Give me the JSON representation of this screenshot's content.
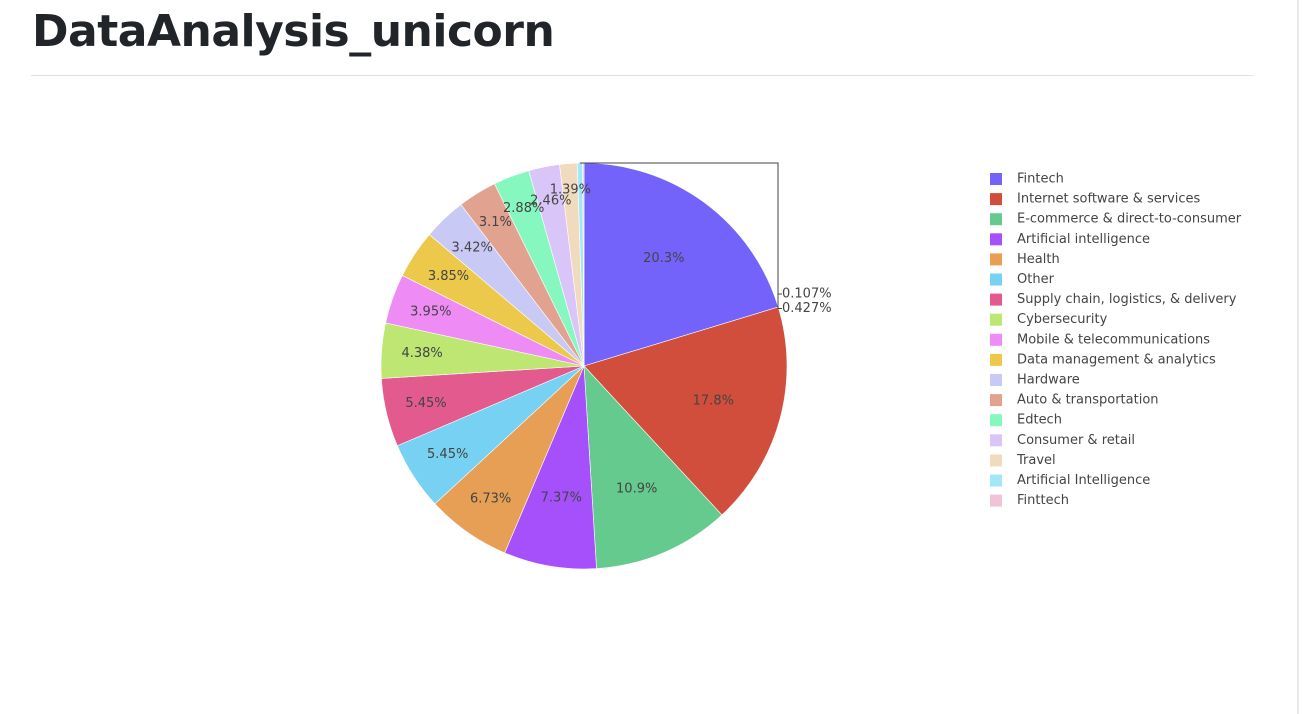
{
  "page": {
    "title": "DataAnalysis_unicorn"
  },
  "chart_data": {
    "type": "pie",
    "direction": "clockwise",
    "start": "12 o'clock",
    "legend_placement": "right",
    "slices": [
      {
        "name": "Fintech",
        "percent": 20.3,
        "label": "20.3%",
        "color": "#7463fb",
        "label_color": "#ffffff"
      },
      {
        "name": "Internet software & services",
        "percent": 17.8,
        "label": "17.8%",
        "color": "#d14e3c",
        "label_color": "#444444"
      },
      {
        "name": "E-commerce & direct-to-consumer",
        "percent": 10.9,
        "label": "10.9%",
        "color": "#64ca8e",
        "label_color": "#444444"
      },
      {
        "name": "Artificial intelligence",
        "percent": 7.37,
        "label": "7.37%",
        "color": "#a650fb",
        "label_color": "#444444"
      },
      {
        "name": "Health",
        "percent": 6.73,
        "label": "6.73%",
        "color": "#e69f55",
        "label_color": "#444444"
      },
      {
        "name": "Other",
        "percent": 5.45,
        "label": "5.45%",
        "color": "#76d1f3",
        "label_color": "#444444"
      },
      {
        "name": "Supply chain, logistics, & delivery",
        "percent": 5.45,
        "label": "5.45%",
        "color": "#e35a8f",
        "label_color": "#444444"
      },
      {
        "name": "Cybersecurity",
        "percent": 4.38,
        "label": "4.38%",
        "color": "#bde672",
        "label_color": "#444444"
      },
      {
        "name": "Mobile & telecommunications",
        "percent": 3.95,
        "label": "3.95%",
        "color": "#ee8bf4",
        "label_color": "#444444"
      },
      {
        "name": "Data management & analytics",
        "percent": 3.85,
        "label": "3.85%",
        "color": "#ecc94a",
        "label_color": "#444444"
      },
      {
        "name": "Hardware",
        "percent": 3.42,
        "label": "3.42%",
        "color": "#c9c9f5",
        "label_color": "#444444"
      },
      {
        "name": "Auto & transportation",
        "percent": 3.1,
        "label": "3.1%",
        "color": "#e2a290",
        "label_color": "#444444"
      },
      {
        "name": "Edtech",
        "percent": 2.88,
        "label": "2.88%",
        "color": "#86f8bf",
        "label_color": "#444444"
      },
      {
        "name": "Consumer & retail",
        "percent": 2.46,
        "label": "2.46%",
        "color": "#dac5f8",
        "label_color": "#444444"
      },
      {
        "name": "Travel",
        "percent": 1.39,
        "label": "1.39%",
        "color": "#f1dbbe",
        "label_color": "#444444"
      },
      {
        "name": "Artificial Intelligence",
        "percent": 0.427,
        "label": "0.427%",
        "color": "#a2e7f8",
        "label_color": "#444444"
      },
      {
        "name": "Finttech",
        "percent": 0.107,
        "label": "0.107%",
        "color": "#f2c2d8",
        "label_color": "#444444"
      }
    ]
  }
}
